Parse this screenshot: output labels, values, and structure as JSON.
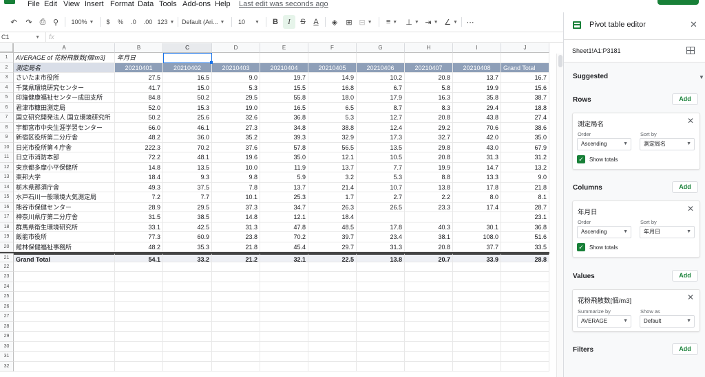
{
  "menu": {
    "items": [
      "File",
      "Edit",
      "View",
      "Insert",
      "Format",
      "Data",
      "Tools",
      "Add-ons",
      "Help"
    ],
    "last_edit": "Last edit was seconds ago"
  },
  "toolbar": {
    "zoom": "100%",
    "currency": "$",
    "percent": "%",
    "decrease_decimal": ".0",
    "increase_decimal": ".00",
    "more_formats": "123",
    "font": "Default (Ari...",
    "font_size": "10",
    "bold": "B",
    "italic": "I",
    "strikethrough": "S",
    "text_color": "A",
    "more": "⋯"
  },
  "formula_bar": {
    "cell_ref": "C1",
    "fx": "fx"
  },
  "grid": {
    "columns": [
      "A",
      "B",
      "C",
      "D",
      "E",
      "F",
      "G",
      "H",
      "I",
      "J"
    ],
    "selected_column": "C",
    "rows": [
      [
        "AVERAGE of 花粉飛散数[個/m3]",
        "年月日",
        "",
        "",
        "",
        "",
        "",
        "",
        "",
        ""
      ],
      [
        "測定局名",
        "20210401",
        "20210402",
        "20210403",
        "20210404",
        "20210405",
        "20210406",
        "20210407",
        "20210408",
        "Grand Total"
      ],
      [
        "さいたま市役所",
        "27.5",
        "16.5",
        "9.0",
        "19.7",
        "14.9",
        "10.2",
        "20.8",
        "13.7",
        "16.7"
      ],
      [
        "千葉県環境研究センター",
        "41.7",
        "15.0",
        "5.3",
        "15.5",
        "16.8",
        "6.7",
        "5.8",
        "19.9",
        "15.6"
      ],
      [
        "印旛健康福祉センター成田支所",
        "84.8",
        "50.2",
        "29.5",
        "55.8",
        "18.0",
        "17.9",
        "16.3",
        "35.8",
        "38.7"
      ],
      [
        "君津市糠田測定局",
        "52.0",
        "15.3",
        "19.0",
        "16.5",
        "6.5",
        "8.7",
        "8.3",
        "29.4",
        "18.8"
      ],
      [
        "国立研究開発法人 国立環境研究所",
        "50.2",
        "25.6",
        "32.6",
        "36.8",
        "5.3",
        "12.7",
        "20.8",
        "43.8",
        "27.4"
      ],
      [
        "宇都宮市中央生涯学習センター",
        "66.0",
        "46.1",
        "27.3",
        "34.8",
        "38.8",
        "12.4",
        "29.2",
        "70.6",
        "38.6"
      ],
      [
        "新宿区役所第二分庁舎",
        "48.2",
        "36.0",
        "35.2",
        "39.3",
        "32.9",
        "17.3",
        "32.7",
        "42.0",
        "35.0"
      ],
      [
        "日光市役所第４庁舎",
        "222.3",
        "70.2",
        "37.6",
        "57.8",
        "56.5",
        "13.5",
        "29.8",
        "43.0",
        "67.9"
      ],
      [
        "日立市消防本部",
        "72.2",
        "48.1",
        "19.6",
        "35.0",
        "12.1",
        "10.5",
        "20.8",
        "31.3",
        "31.2"
      ],
      [
        "東京都多摩小平保健所",
        "14.8",
        "13.5",
        "10.0",
        "11.9",
        "13.7",
        "7.7",
        "19.9",
        "14.7",
        "13.2"
      ],
      [
        "東邦大学",
        "18.4",
        "9.3",
        "9.8",
        "5.9",
        "3.2",
        "5.3",
        "8.8",
        "13.3",
        "9.0"
      ],
      [
        "栃木県那須庁舎",
        "49.3",
        "37.5",
        "7.8",
        "13.7",
        "21.4",
        "10.7",
        "13.8",
        "17.8",
        "21.8"
      ],
      [
        "水戸石川一般環境大気測定局",
        "7.2",
        "7.7",
        "10.1",
        "25.3",
        "1.7",
        "2.7",
        "2.2",
        "8.0",
        "8.1"
      ],
      [
        "熊谷市保健センター",
        "28.9",
        "29.5",
        "37.3",
        "34.7",
        "26.3",
        "26.5",
        "23.3",
        "17.4",
        "28.7"
      ],
      [
        "神奈川県庁第二分庁舎",
        "31.5",
        "38.5",
        "14.8",
        "12.1",
        "18.4",
        "",
        "",
        "",
        "23.1"
      ],
      [
        "群馬県衛生環境研究所",
        "33.1",
        "42.5",
        "31.3",
        "47.8",
        "48.5",
        "17.8",
        "40.3",
        "30.1",
        "36.8"
      ],
      [
        "飯能市役所",
        "77.3",
        "60.9",
        "23.8",
        "70.2",
        "39.7",
        "23.4",
        "38.1",
        "108.0",
        "51.6"
      ],
      [
        "館林保健福祉事務所",
        "48.2",
        "35.3",
        "21.8",
        "45.4",
        "29.7",
        "31.3",
        "20.8",
        "37.7",
        "33.5"
      ],
      [
        "Grand Total",
        "54.1",
        "33.2",
        "21.2",
        "32.1",
        "22.5",
        "13.8",
        "20.7",
        "33.9",
        "28.8"
      ]
    ],
    "row_numbers": [
      "1",
      "2",
      "3",
      "4",
      "5",
      "6",
      "7",
      "8",
      "9",
      "10",
      "11",
      "12",
      "13",
      "14",
      "15",
      "16",
      "17",
      "18",
      "19",
      "20",
      "21",
      "22",
      "23",
      "24",
      "25",
      "26",
      "27",
      "28",
      "29",
      "30",
      "31",
      "32"
    ]
  },
  "panel": {
    "title": "Pivot table editor",
    "range": "Sheet1!A1:P3181",
    "suggested": "Suggested",
    "rows_label": "Rows",
    "columns_label": "Columns",
    "values_label": "Values",
    "filters_label": "Filters",
    "add": "Add",
    "rows_card": {
      "title": "測定局名",
      "order_label": "Order",
      "order": "Ascending",
      "sortby_label": "Sort by",
      "sortby": "測定局名",
      "show_totals": "Show totals"
    },
    "columns_card": {
      "title": "年月日",
      "order_label": "Order",
      "order": "Ascending",
      "sortby_label": "Sort by",
      "sortby": "年月日",
      "show_totals": "Show totals"
    },
    "values_card": {
      "title": "花粉飛散数[個/m3]",
      "summarize_label": "Summarize by",
      "summarize": "AVERAGE",
      "showas_label": "Show as",
      "showas": "Default"
    }
  }
}
